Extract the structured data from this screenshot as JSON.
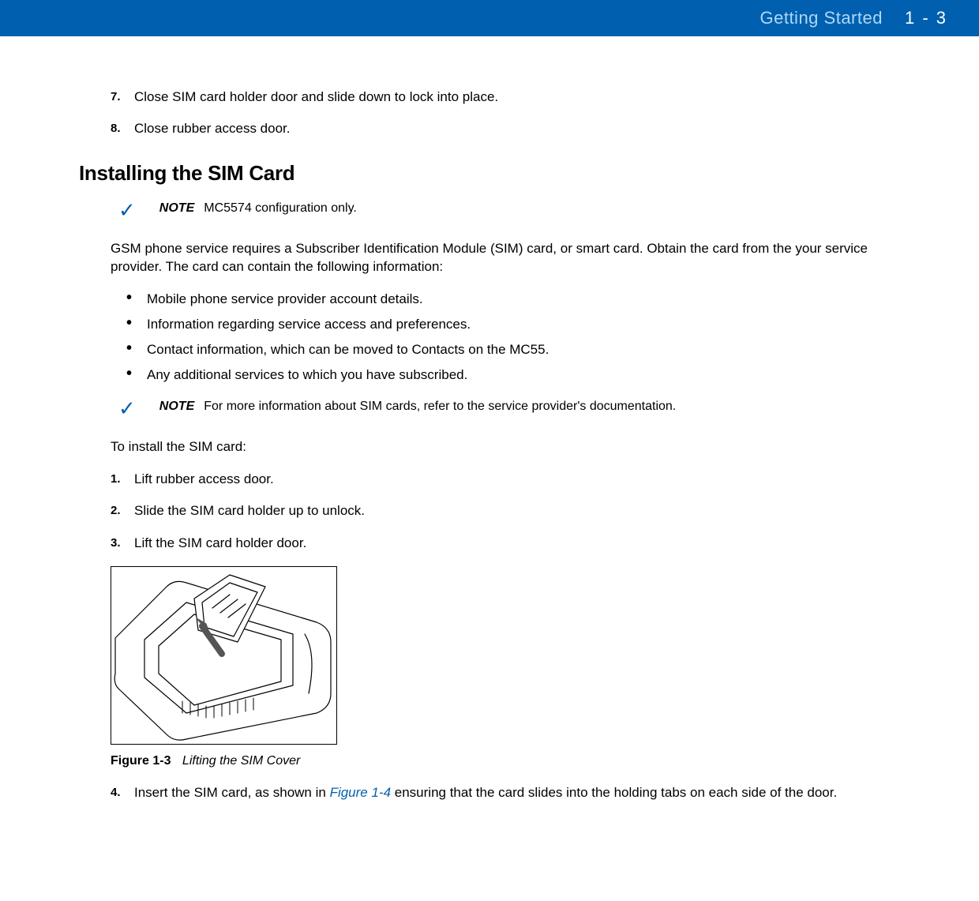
{
  "header": {
    "chapter": "Getting Started",
    "page": "1 - 3"
  },
  "top_steps": [
    {
      "num": "7.",
      "text": "Close SIM card holder door and slide down to lock into place."
    },
    {
      "num": "8.",
      "text": "Close rubber access door."
    }
  ],
  "section_title": "Installing the SIM Card",
  "note1": {
    "label": "NOTE",
    "text": "MC5574 configuration only."
  },
  "intro_para": "GSM phone service requires a Subscriber Identification Module (SIM) card, or smart card. Obtain the card from the your service provider. The card can contain the following information:",
  "bullets": [
    "Mobile phone service provider account details.",
    "Information regarding service access and preferences.",
    "Contact information, which can be moved to Contacts on the MC55.",
    "Any additional services to which you have subscribed."
  ],
  "note2": {
    "label": "NOTE",
    "text": "For more information about SIM cards, refer to the service provider's documentation."
  },
  "install_intro": "To install the SIM card:",
  "install_steps": [
    {
      "num": "1.",
      "text": "Lift rubber access door."
    },
    {
      "num": "2.",
      "text": "Slide the SIM card holder up to unlock."
    },
    {
      "num": "3.",
      "text": "Lift the SIM card holder door."
    }
  ],
  "figure": {
    "label": "Figure 1-3",
    "title": "Lifting the SIM Cover"
  },
  "step4": {
    "num": "4.",
    "pre": "Insert the SIM card, as shown in ",
    "ref": "Figure 1-4",
    "post": " ensuring that the card slides into the holding tabs on each side of the door."
  }
}
